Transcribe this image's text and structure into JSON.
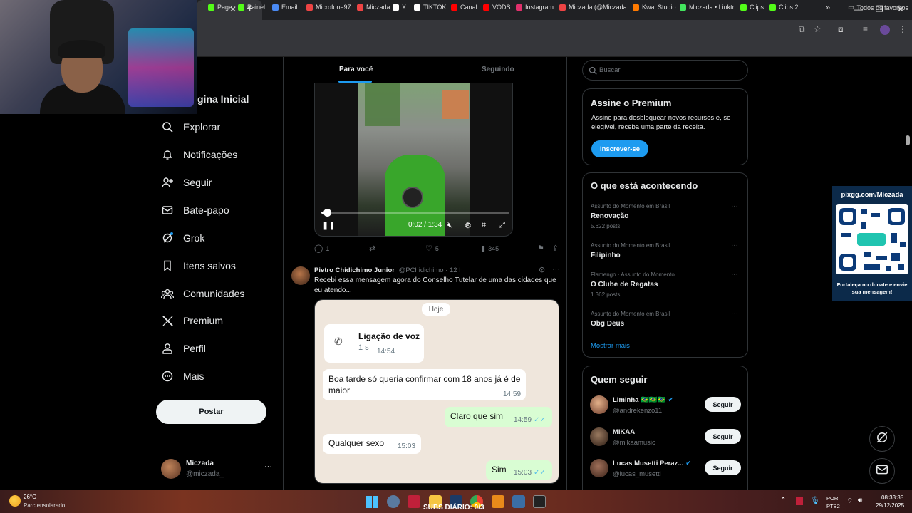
{
  "browser": {
    "bookmarks": [
      {
        "label": "Page",
        "color": "#53fc18"
      },
      {
        "label": "Painel",
        "color": "#53fc18"
      },
      {
        "label": "Email",
        "color": "#4a8af4"
      },
      {
        "label": "Microfone97",
        "color": "#e44"
      },
      {
        "label": "Miczada",
        "color": "#e44"
      },
      {
        "label": "X",
        "color": "#ffffff"
      },
      {
        "label": "TIKTOK",
        "color": "#ffffff"
      },
      {
        "label": "Canal",
        "color": "#ff0000"
      },
      {
        "label": "VODS",
        "color": "#ff0000"
      },
      {
        "label": "Instagram",
        "color": "#e1306c"
      },
      {
        "label": "Miczada (@Miczada...",
        "color": "#e44"
      },
      {
        "label": "Kwai Studio",
        "color": "#ff7a00"
      },
      {
        "label": "Miczada • Linktr",
        "color": "#43e55e"
      },
      {
        "label": "Clips",
        "color": "#53fc18"
      },
      {
        "label": "Clips 2",
        "color": "#53fc18"
      }
    ],
    "all_favorites": "Todos os favoritos"
  },
  "nav": {
    "home_title": "gina Inicial",
    "items": [
      {
        "label": "Explorar",
        "icon": "search-icon"
      },
      {
        "label": "Notificações",
        "icon": "bell-icon"
      },
      {
        "label": "Seguir",
        "icon": "add-person-icon"
      },
      {
        "label": "Bate-papo",
        "icon": "mail-icon"
      },
      {
        "label": "Grok",
        "icon": "grok-icon"
      },
      {
        "label": "Itens salvos",
        "icon": "bookmark-icon"
      },
      {
        "label": "Comunidades",
        "icon": "communities-icon"
      },
      {
        "label": "Premium",
        "icon": "x-logo-icon"
      },
      {
        "label": "Perfil",
        "icon": "person-icon"
      },
      {
        "label": "Mais",
        "icon": "more-circle-icon"
      }
    ],
    "post_label": "Postar",
    "account": {
      "name": "Miczada",
      "handle": "@miczada_",
      "more": "···"
    }
  },
  "feed": {
    "tabs": [
      {
        "label": "Para você",
        "active": true
      },
      {
        "label": "Seguindo",
        "active": false
      }
    ],
    "video": {
      "time": "0:02 / 1:34",
      "progress": 0.03
    },
    "post1_actions": {
      "replies": "1",
      "likes": "5",
      "views": "345"
    },
    "post2": {
      "author": "Pietro Chidichimo Junior",
      "handle": "@PChidichimo · 12 h",
      "text": "Recebi essa mensagem agora do Conselho Tutelar de uma das cidades que eu atendo...",
      "chat": {
        "date": "Hoje",
        "call_title": "Ligação de voz",
        "call_duration": "1 s",
        "call_time": "14:54",
        "msg1": "Boa tarde só  queria confirmar  com 18 anos já é  de maior",
        "msg1_time": "14:59",
        "msg2": "Claro que sim",
        "msg2_time": "14:59",
        "msg3": "Qualquer sexo",
        "msg3_time": "15:03",
        "msg4": "Sim",
        "msg4_time": "15:03"
      }
    }
  },
  "sidebar": {
    "search_placeholder": "Buscar",
    "premium": {
      "title": "Assine o Premium",
      "text": "Assine para desbloquear novos recursos e, se elegível, receba uma parte da receita.",
      "button": "Inscrever-se"
    },
    "trends": {
      "title": "O que está acontecendo",
      "items": [
        {
          "category": "Assunto do Momento em Brasil",
          "name": "Renovação",
          "count": "5.622 posts"
        },
        {
          "category": "Assunto do Momento em Brasil",
          "name": "Filipinho",
          "count": ""
        },
        {
          "category": "Flamengo · Assunto do Momento",
          "name": "O Clube de Regatas",
          "count": "1.362 posts"
        },
        {
          "category": "Assunto do Momento em Brasil",
          "name": "Obg Deus",
          "count": ""
        }
      ],
      "show_more": "Mostrar mais"
    },
    "who_to_follow": {
      "title": "Quem seguir",
      "follow_label": "Seguir",
      "items": [
        {
          "name": "Liminha 🇧🇷🇧🇷🇧🇷",
          "handle": "@andrekenzo11",
          "verified": true
        },
        {
          "name": "MIKAA",
          "handle": "@mikaamusic",
          "verified": false
        },
        {
          "name": "Lucas Musetti Peraz...",
          "handle": "@lucas_musetti",
          "verified": true
        }
      ]
    }
  },
  "overlay": {
    "qr_title": "pixgg.com/Miczada",
    "qr_caption": "Fortaleça no donate e envie sua mensagem!"
  },
  "taskbar": {
    "weather_temp": "26°C",
    "weather_desc": "Parc ensolarado",
    "subs": "SUBS DIÁRIO: 0/3",
    "lang_top": "POR",
    "lang_bottom": "PTB2",
    "time": "08:33:35",
    "date": "29/12/2025"
  }
}
